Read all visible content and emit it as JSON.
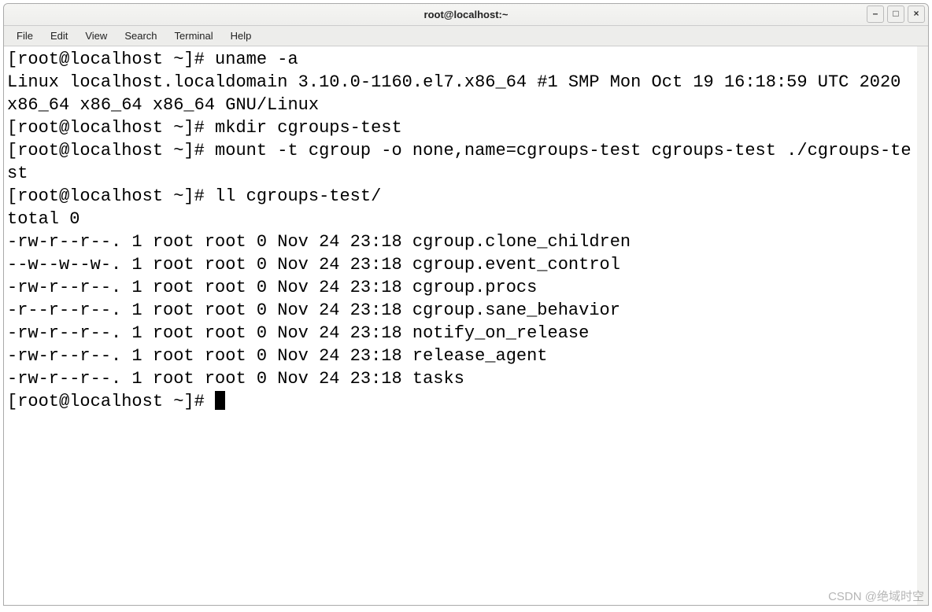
{
  "window_title": "root@localhost:~",
  "menu": {
    "file": "File",
    "edit": "Edit",
    "view": "View",
    "search": "Search",
    "terminal": "Terminal",
    "help": "Help"
  },
  "win_btn": {
    "minimize": "–",
    "maximize": "□",
    "close": "×"
  },
  "terminal": {
    "prompt": "[root@localhost ~]# ",
    "cmd_uname": "uname -a",
    "out_uname": "Linux localhost.localdomain 3.10.0-1160.el7.x86_64 #1 SMP Mon Oct 19 16:18:59 UTC 2020 x86_64 x86_64 x86_64 GNU/Linux",
    "cmd_mkdir": "mkdir cgroups-test",
    "cmd_mount": "mount -t cgroup -o none,name=cgroups-test cgroups-test ./cgroups-test",
    "cmd_ll": "ll cgroups-test/",
    "out_total": "total 0",
    "ls": [
      "-rw-r--r--. 1 root root 0 Nov 24 23:18 cgroup.clone_children",
      "--w--w--w-. 1 root root 0 Nov 24 23:18 cgroup.event_control",
      "-rw-r--r--. 1 root root 0 Nov 24 23:18 cgroup.procs",
      "-r--r--r--. 1 root root 0 Nov 24 23:18 cgroup.sane_behavior",
      "-rw-r--r--. 1 root root 0 Nov 24 23:18 notify_on_release",
      "-rw-r--r--. 1 root root 0 Nov 24 23:18 release_agent",
      "-rw-r--r--. 1 root root 0 Nov 24 23:18 tasks"
    ]
  },
  "watermark": "CSDN @绝域时空"
}
